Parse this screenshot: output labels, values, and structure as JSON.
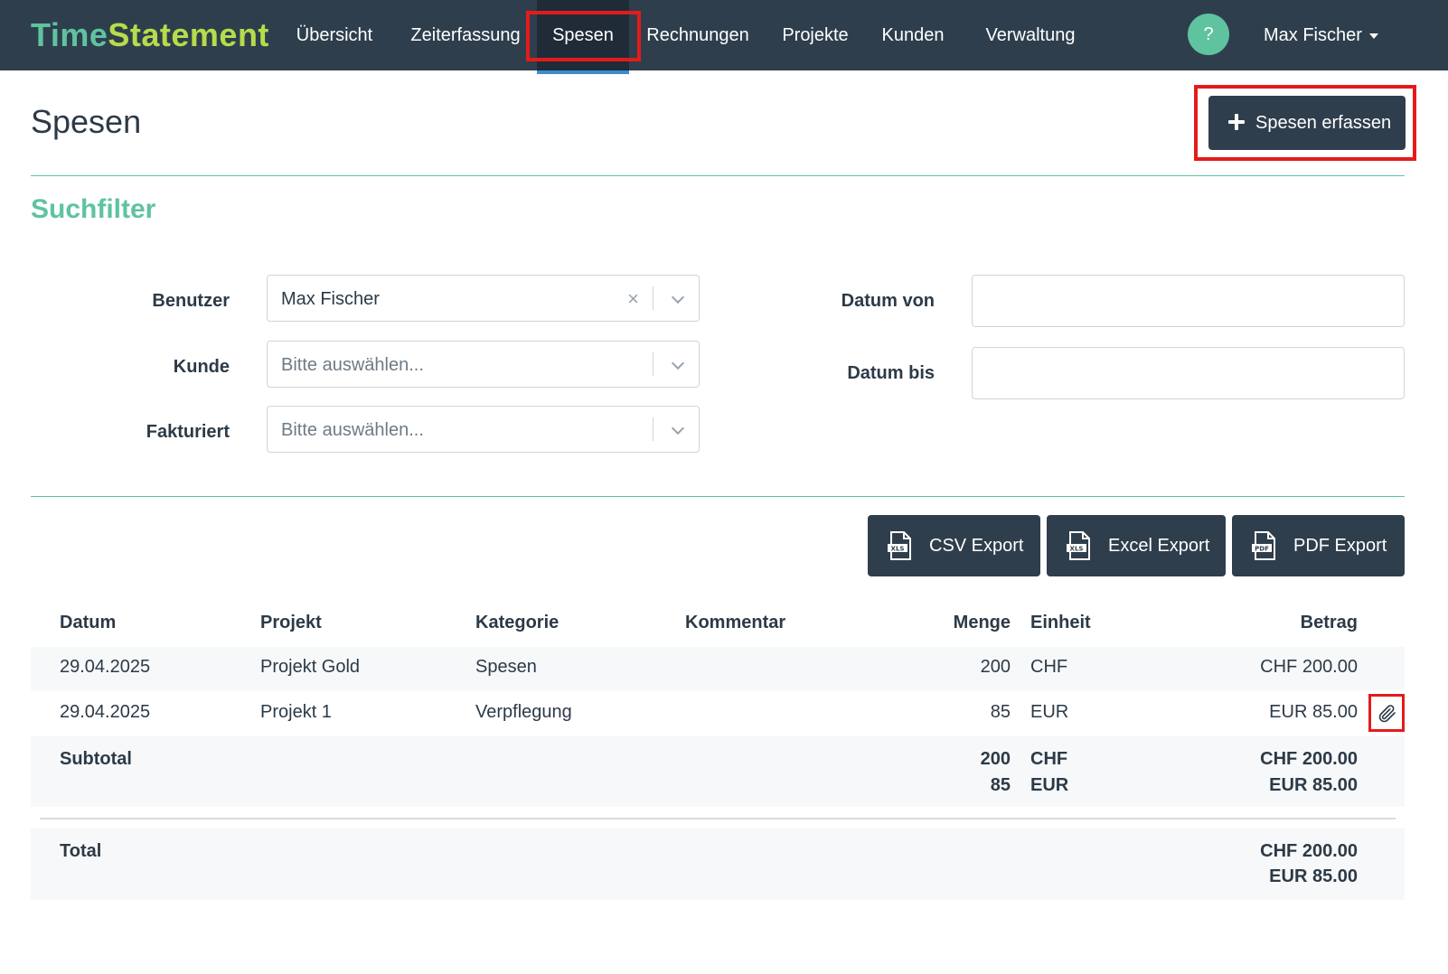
{
  "brand": {
    "part1": "Time",
    "part2": "Statement"
  },
  "nav": {
    "items": [
      "Übersicht",
      "Zeiterfassung",
      "Spesen",
      "Rechnungen",
      "Projekte",
      "Kunden",
      "Verwaltung"
    ],
    "active": "Spesen",
    "help": "?",
    "user": "Max Fischer"
  },
  "page": {
    "title": "Spesen",
    "add_button": "Spesen erfassen"
  },
  "filter": {
    "title": "Suchfilter",
    "benutzer_label": "Benutzer",
    "benutzer_value": "Max Fischer",
    "kunde_label": "Kunde",
    "kunde_placeholder": "Bitte auswählen...",
    "fakturiert_label": "Fakturiert",
    "fakturiert_placeholder": "Bitte auswählen...",
    "datum_von_label": "Datum von",
    "datum_bis_label": "Datum bis"
  },
  "exports": {
    "csv": "CSV Export",
    "excel": "Excel Export",
    "pdf": "PDF Export",
    "csv_icon_text": "XLS",
    "excel_icon_text": "XLS",
    "pdf_icon_text": "PDF"
  },
  "table": {
    "headers": {
      "datum": "Datum",
      "projekt": "Projekt",
      "kategorie": "Kategorie",
      "kommentar": "Kommentar",
      "menge": "Menge",
      "einheit": "Einheit",
      "betrag": "Betrag"
    },
    "rows": [
      {
        "datum": "29.04.2025",
        "projekt": "Projekt Gold",
        "kategorie": "Spesen",
        "kommentar": "",
        "menge": "200",
        "einheit": "CHF",
        "betrag": "CHF 200.00"
      },
      {
        "datum": "29.04.2025",
        "projekt": "Projekt 1",
        "kategorie": "Verpflegung",
        "kommentar": "",
        "menge": "85",
        "einheit": "EUR",
        "betrag": "EUR 85.00"
      }
    ],
    "subtotal": {
      "label": "Subtotal",
      "menge1": "200",
      "einheit1": "CHF",
      "betrag1": "CHF 200.00",
      "menge2": "85",
      "einheit2": "EUR",
      "betrag2": "EUR 85.00"
    },
    "total": {
      "label": "Total",
      "betrag1": "CHF 200.00",
      "betrag2": "EUR 85.00"
    }
  },
  "colors": {
    "navbar": "#2f3e4d",
    "accent_green": "#5fc3a0",
    "brand_lime": "#b6dc4a",
    "highlight_red": "#e41b1b"
  },
  "icons": {
    "add": "plus-icon",
    "export": "file-icon",
    "attachment": "paperclip-icon",
    "user_menu": "caret-down-icon",
    "select_toggle": "chevron-down-icon",
    "select_clear": "clear-icon"
  }
}
